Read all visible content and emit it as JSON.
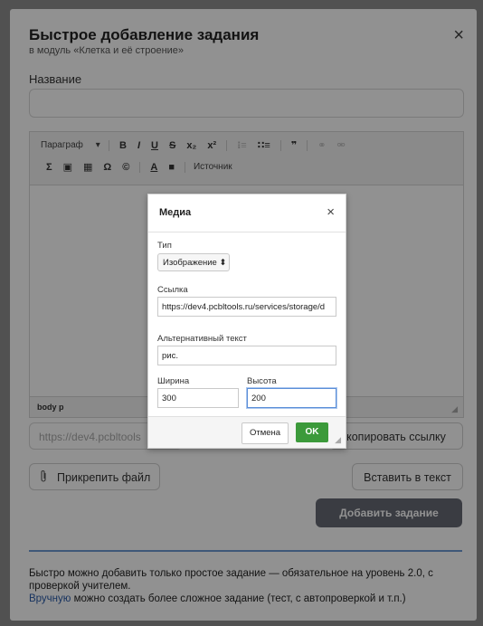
{
  "modal": {
    "title": "Быстрое добавление задания",
    "subtitle": "в модуль «Клетка и её строение»",
    "close_glyph": "×",
    "name_label": "Название",
    "name_value": ""
  },
  "editor": {
    "toolbar_row1": {
      "format_label": "Параграф",
      "format_caret": "▾",
      "bold": "B",
      "italic": "I",
      "underline": "U",
      "strike": "S",
      "subscript": "x₂",
      "superscript": "x²",
      "ordered_list": "⁝≡",
      "bullet_list": "∷≡",
      "blockquote": "❞",
      "link": "⚭",
      "unlink": "⚮"
    },
    "toolbar_row2": {
      "formula": "Σ",
      "image": "▣",
      "table": "▦",
      "special_char": "Ω",
      "copyright": "©",
      "text_color": "A",
      "bg_color": "■",
      "source_label": "Источник"
    },
    "statusbar_path": "body  p"
  },
  "link_input_placeholder": "https://dev4.pcbltools",
  "buttons": {
    "copy_link": "копировать ссылку",
    "attach_file": "Прикрепить файл",
    "insert_text": "Вставить в текст",
    "add_task": "Добавить задание"
  },
  "footer": {
    "line1": "Быстро можно добавить только простое задание — обязательное на уровень 2.0, с проверкой учителем.",
    "link_text": "Вручную",
    "line2_rest": " можно создать более сложное задание (тест, с автопроверкой и т.п.)"
  },
  "media_dialog": {
    "title": "Медиа",
    "close_glyph": "×",
    "type_label": "Тип",
    "type_value": "Изображение ⬍",
    "url_label": "Ссылка",
    "url_value": "https://dev4.pcbltools.ru/services/storage/d",
    "alt_label": "Альтернативный текст",
    "alt_value": "рис.",
    "width_label": "Ширина",
    "width_value": "300",
    "height_label": "Высота",
    "height_value": "200",
    "cancel_label": "Отмена",
    "ok_label": "OK"
  },
  "colors": {
    "ok_green": "#3c9a3b",
    "add_button": "#666a75",
    "divider_blue": "#6f9bd3",
    "link_blue": "#2a5aa8"
  }
}
